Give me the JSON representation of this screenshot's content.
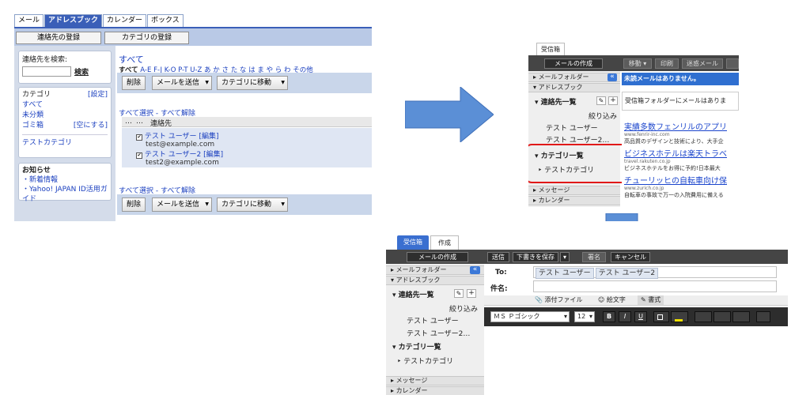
{
  "old_ui": {
    "tabs": [
      "メール",
      "アドレスブック",
      "カレンダー",
      "ボックス"
    ],
    "active_tab": "アドレスブック",
    "toolbar": {
      "register_contact": "連絡先の登録",
      "register_category": "カテゴリの登録"
    },
    "search": {
      "label": "連絡先を検索:",
      "button": "検索",
      "value": ""
    },
    "category": {
      "header": "カテゴリ",
      "settings": "[設定]",
      "items": [
        "すべて",
        "未分類",
        "ゴミ箱"
      ],
      "empty_trash": "[空にする]",
      "custom": "テストカテゴリ"
    },
    "news": {
      "header": "お知らせ",
      "items": [
        "・新着情報",
        "・Yahoo! JAPAN ID活用ガイド"
      ]
    },
    "main": {
      "heading": "すべて",
      "index_all": "すべて",
      "index_letters": [
        "A-E",
        "F-J",
        "K-O",
        "P-T",
        "U-Z",
        "あ",
        "か",
        "さ",
        "た",
        "な",
        "は",
        "ま",
        "や",
        "ら",
        "わ",
        "その他"
      ],
      "actions": {
        "delete": "削除",
        "send_mail": "メールを送信",
        "move_category": "カテゴリに移動",
        "dropdown": "▼"
      },
      "select_all": "すべて選択",
      "deselect_all": "すべて解除",
      "select_separator": " - ",
      "col_dots1": "…",
      "col_dots2": "…",
      "col_contact": "連絡先",
      "contacts": [
        {
          "name": "テスト ユーザー",
          "edit": "[編集]",
          "email": "test@example.com"
        },
        {
          "name": "テスト ユーザー2",
          "edit": "[編集]",
          "email": "test2@example.com"
        }
      ]
    }
  },
  "new_ui": {
    "tab_inbox": "受信箱",
    "compose_button": "メールの作成",
    "toolbar_buttons": [
      "移動 ▾",
      "印刷",
      "迷惑メール"
    ],
    "collapse_glyph": "«",
    "mail_folder": "メールフォルダー",
    "address_book": "アドレスブック",
    "contact_list": "連絡先一覧",
    "pencil_glyph": "✎",
    "plus_glyph": "+",
    "filter": "絞り込み",
    "contacts": [
      "テスト ユーザー",
      "テスト ユーザー2…"
    ],
    "category_list": "カテゴリ一覧",
    "category_item": "テストカテゴリ",
    "messages": "メッセージ",
    "calendar": "カレンダー",
    "unread_notice": "未読メールはありません。",
    "inbox_notice": "受信箱フォルダーにメールはありま",
    "ads": [
      {
        "title": "実績多数フェンリルのアプリ",
        "url": "www.fenrir-inc.com",
        "desc": "高品質のデザインと技術により、大手企"
      },
      {
        "title": "ビジネスホテルは楽天トラベ",
        "url": "travel.rakuten.co.jp",
        "desc": "ビジネスホテルをお得に予約!日本最大"
      },
      {
        "title": "チューリッヒの自転車向け保",
        "url": "www.zurich.co.jp",
        "desc": "自転車の事故で万一の入院費用に備える"
      }
    ]
  },
  "compose_ui": {
    "tab_inbox": "受信箱",
    "tab_compose": "作成",
    "compose_button": "メールの作成",
    "send": "送信",
    "save_draft": "下書きを保存",
    "dropdown": "▾",
    "signature": "署名",
    "cancel": "キャンセル",
    "collapse_glyph": "«",
    "mail_folder": "メールフォルダー",
    "address_book": "アドレスブック",
    "contact_list": "連絡先一覧",
    "pencil_glyph": "✎",
    "plus_glyph": "+",
    "filter": "絞り込み",
    "contacts": [
      "テスト ユーザー",
      "テスト ユーザー2…"
    ],
    "category_list": "カテゴリ一覧",
    "category_item": "テストカテゴリ",
    "messages": "メッセージ",
    "calendar": "カレンダー",
    "to_label": "To:",
    "to_chips": [
      "テスト ユーザー",
      "テスト ユーザー2"
    ],
    "subject_label": "件名:",
    "attach": "添付ファイル",
    "emoji": "絵文字",
    "formatting": "書式",
    "font": "ＭＳ Ｐゴシック",
    "font_size": "12",
    "bold": "B",
    "italic": "I",
    "underline": "U"
  },
  "colors": {
    "accent": "#3a5fb8",
    "highlight_box": "#e01818",
    "arrow": "#5b8fd6",
    "dark_toolbar": "#454545"
  }
}
